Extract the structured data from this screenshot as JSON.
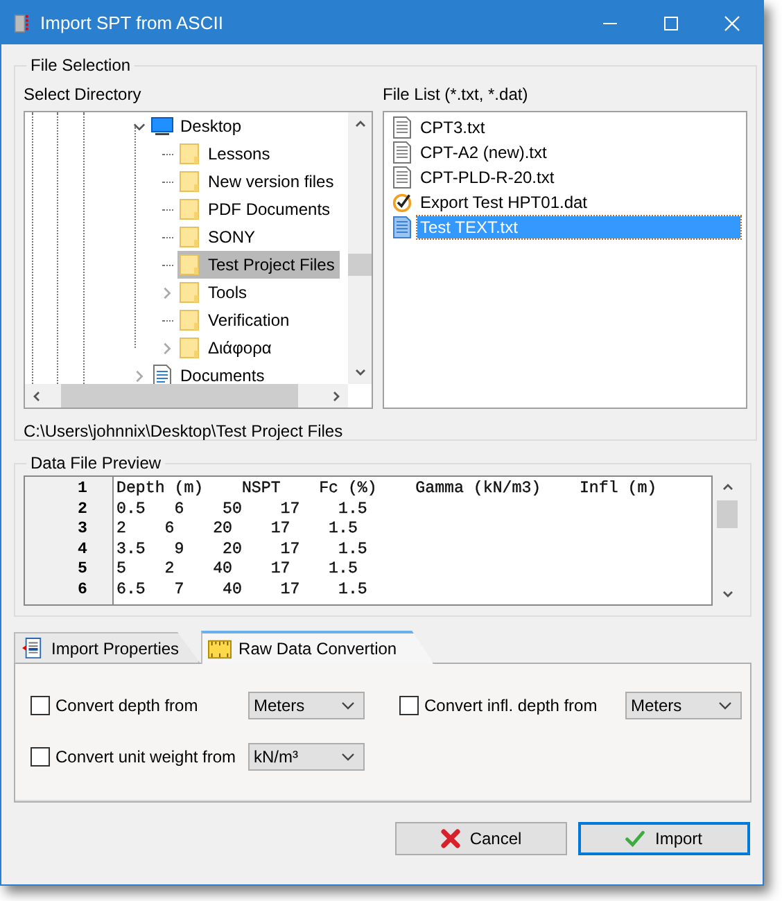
{
  "window": {
    "title": "Import SPT from ASCII"
  },
  "file_selection": {
    "title": "File Selection",
    "directory_label": "Select Directory",
    "file_list_label": "File List (*.txt, *.dat)",
    "tree": [
      {
        "label": "Desktop",
        "kind": "desktop",
        "expanded": true,
        "selected": false,
        "children": [
          {
            "label": "Lessons",
            "kind": "folder",
            "selected": false
          },
          {
            "label": "New version files",
            "kind": "folder",
            "selected": false
          },
          {
            "label": "PDF Documents",
            "kind": "folder",
            "selected": false
          },
          {
            "label": "SONY",
            "kind": "folder",
            "selected": false
          },
          {
            "label": "Test Project Files",
            "kind": "folder",
            "selected": true
          },
          {
            "label": "Tools",
            "kind": "folder",
            "expanded": false,
            "selected": false
          },
          {
            "label": "Verification",
            "kind": "folder",
            "selected": false
          },
          {
            "label": "Διάφορα",
            "kind": "folder",
            "expanded": false,
            "selected": false
          }
        ]
      },
      {
        "label": "Documents",
        "kind": "documents",
        "expanded": false,
        "selected": false
      }
    ],
    "files": [
      {
        "name": "CPT3.txt",
        "kind": "text",
        "selected": false
      },
      {
        "name": "CPT-A2 (new).txt",
        "kind": "text",
        "selected": false
      },
      {
        "name": "CPT-PLD-R-20.txt",
        "kind": "text",
        "selected": false
      },
      {
        "name": "Export Test HPT01.dat",
        "kind": "checked",
        "selected": false
      },
      {
        "name": "Test TEXT.txt",
        "kind": "text",
        "selected": true
      }
    ],
    "path": "C:\\Users\\johnnix\\Desktop\\Test Project Files"
  },
  "preview": {
    "title": "Data File Preview",
    "lines": [
      {
        "number": "1",
        "text": "Depth (m)    NSPT    Fc (%)    Gamma (kN/m3)    Infl (m)"
      },
      {
        "number": "2",
        "text": "0.5   6    50    17    1.5"
      },
      {
        "number": "3",
        "text": "2    6    20    17    1.5"
      },
      {
        "number": "4",
        "text": "3.5   9    20    17    1.5"
      },
      {
        "number": "5",
        "text": "5    2    40    17    1.5"
      },
      {
        "number": "6",
        "text": "6.5   7    40    17    1.5"
      }
    ]
  },
  "tabs": [
    {
      "label": "Import Properties",
      "kind": "properties",
      "selected": false
    },
    {
      "label": "Raw Data Convertion",
      "kind": "ruler",
      "selected": true
    }
  ],
  "conversions": [
    {
      "label": "Convert depth from",
      "checked": false,
      "unit": "Meters"
    },
    {
      "label": "Convert infl. depth from",
      "checked": false,
      "unit": "Meters"
    },
    {
      "label": "Convert unit weight from",
      "checked": false,
      "unit": "kN/m³"
    }
  ],
  "buttons": [
    {
      "label": "Cancel",
      "kind": "cancel",
      "default": false
    },
    {
      "label": "Import",
      "kind": "import",
      "default": true
    }
  ]
}
